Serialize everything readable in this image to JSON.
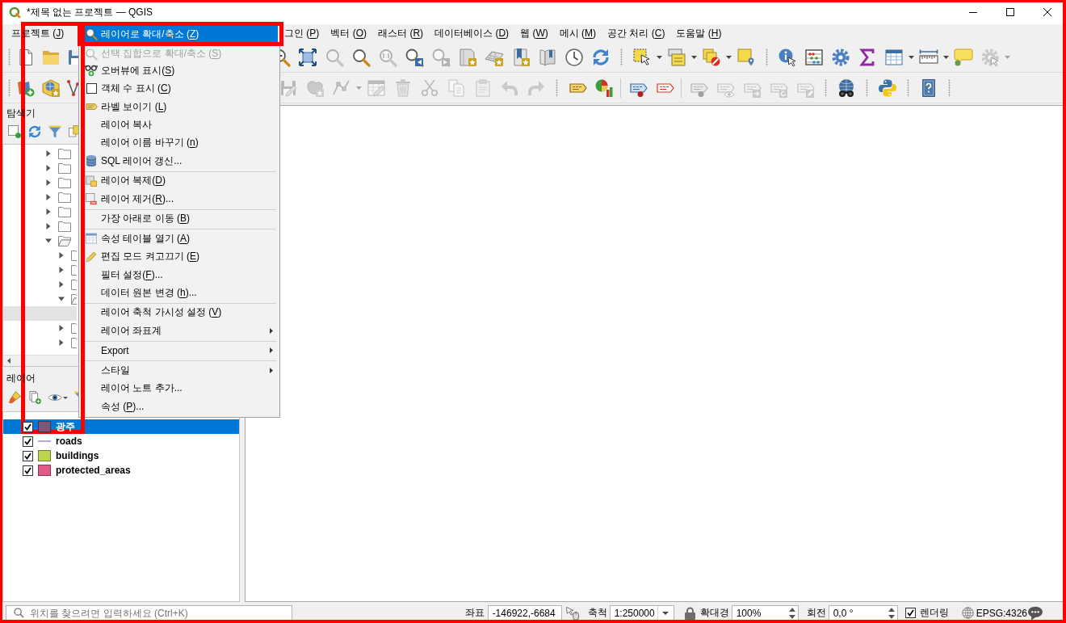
{
  "window": {
    "title": "*제목 없는 프로젝트 — QGIS"
  },
  "menu_bar": {
    "before_popup": [
      {
        "label": "프로젝트 (J)"
      }
    ],
    "after_popup": [
      {
        "label": "그인 (P)"
      },
      {
        "label": "벡터 (O)"
      },
      {
        "label": "래스터 (R)"
      },
      {
        "label": "데이터베이스 (D)"
      },
      {
        "label": "웹 (W)"
      },
      {
        "label": "메시 (M)"
      },
      {
        "label": "공간 처리 (C)"
      },
      {
        "label": "도움말 (H)"
      }
    ]
  },
  "toolbars": [
    {
      "before_popup": [
        {
          "kind": "grip"
        },
        {
          "kind": "new",
          "disabled": false
        },
        {
          "kind": "open",
          "disabled": false
        },
        {
          "kind": "save",
          "disabled": false
        }
      ],
      "after_popup": [
        {
          "kind": "zoomout",
          "disabled": false
        },
        {
          "kind": "zoomfull",
          "disabled": false
        },
        {
          "kind": "zoomselection",
          "disabled": true
        },
        {
          "kind": "zoomlayer",
          "disabled": false
        },
        {
          "kind": "zoomnative",
          "disabled": true
        },
        {
          "kind": "zoomlast",
          "disabled": false
        },
        {
          "kind": "zoomnext",
          "disabled": true
        },
        {
          "kind": "mapview",
          "disabled": false
        },
        {
          "kind": "mapview3d",
          "disabled": false
        },
        {
          "kind": "bookmark",
          "disabled": false
        },
        {
          "kind": "bookmarks",
          "disabled": false
        },
        {
          "kind": "clock",
          "disabled": false
        },
        {
          "kind": "refresh",
          "disabled": false
        },
        {
          "kind": "grip"
        },
        {
          "kind": "select",
          "disabled": false
        },
        {
          "kind": "caret",
          "disabled": false
        },
        {
          "kind": "selectvalue",
          "disabled": false
        },
        {
          "kind": "caret",
          "disabled": false
        },
        {
          "kind": "deselect",
          "disabled": false
        },
        {
          "kind": "caret",
          "disabled": false
        },
        {
          "kind": "selectlocation",
          "disabled": false
        },
        {
          "kind": "grip"
        },
        {
          "kind": "identify",
          "disabled": false
        },
        {
          "kind": "abacus",
          "disabled": false
        },
        {
          "kind": "gear",
          "disabled": false
        },
        {
          "kind": "sigma",
          "disabled": false
        },
        {
          "kind": "table",
          "disabled": false
        },
        {
          "kind": "caret",
          "disabled": false
        },
        {
          "kind": "ruler",
          "disabled": false
        },
        {
          "kind": "caret",
          "disabled": false
        },
        {
          "kind": "maptip",
          "disabled": false
        },
        {
          "kind": "gearplay",
          "disabled": true
        },
        {
          "kind": "caret",
          "disabled": true
        }
      ]
    },
    {
      "before_popup": [
        {
          "kind": "grip"
        },
        {
          "kind": "datasource",
          "disabled": false
        },
        {
          "kind": "globebox",
          "disabled": false
        },
        {
          "kind": "polyline",
          "disabled": false
        }
      ],
      "after_popup": [
        {
          "kind": "saveedits",
          "disabled": true
        },
        {
          "kind": "addpolygon",
          "disabled": true
        },
        {
          "kind": "nodetool",
          "disabled": true
        },
        {
          "kind": "caret",
          "disabled": true
        },
        {
          "kind": "edittable",
          "disabled": true
        },
        {
          "kind": "trash",
          "disabled": true
        },
        {
          "kind": "cut",
          "disabled": true
        },
        {
          "kind": "copy",
          "disabled": true
        },
        {
          "kind": "paste",
          "disabled": true
        },
        {
          "kind": "undo",
          "disabled": true
        },
        {
          "kind": "redo",
          "disabled": true
        },
        {
          "kind": "grip"
        },
        {
          "kind": "label",
          "disabled": false
        },
        {
          "kind": "diagram",
          "disabled": false
        },
        {
          "kind": "separator"
        },
        {
          "kind": "labelpin",
          "disabled": false
        },
        {
          "kind": "labelred",
          "disabled": false
        },
        {
          "kind": "separator"
        },
        {
          "kind": "labelpin",
          "disabled": true
        },
        {
          "kind": "labeleye",
          "disabled": true
        },
        {
          "kind": "labelmove",
          "disabled": true
        },
        {
          "kind": "labelrotate",
          "disabled": true
        },
        {
          "kind": "labeledit",
          "disabled": true
        },
        {
          "kind": "grip"
        },
        {
          "kind": "globebinoculars",
          "disabled": false
        },
        {
          "kind": "grip"
        },
        {
          "kind": "python",
          "disabled": false
        },
        {
          "kind": "grip"
        },
        {
          "kind": "help",
          "disabled": false
        },
        {
          "kind": "grip"
        }
      ]
    }
  ],
  "browser_panel": {
    "title": "탐색기",
    "tree": [
      {
        "expanded": false,
        "selected": false
      },
      {
        "expanded": false,
        "selected": false
      },
      {
        "expanded": false,
        "selected": false
      },
      {
        "expanded": false,
        "selected": false
      },
      {
        "expanded": false,
        "selected": false
      },
      {
        "expanded": false,
        "selected": false
      },
      {
        "expanded": true,
        "selected": false,
        "children": [
          {
            "expanded": false,
            "selected": false
          },
          {
            "expanded": false,
            "selected": false
          },
          {
            "expanded": false,
            "selected": false
          },
          {
            "expanded": true,
            "selected": false,
            "children": [
              {
                "selected": true
              }
            ]
          },
          {
            "expanded": false,
            "selected": false
          },
          {
            "expanded": false,
            "selected": false
          }
        ]
      }
    ]
  },
  "layers_panel": {
    "title": "레이어",
    "layers": [
      {
        "name": "광주",
        "checked": true,
        "selected": true,
        "kind": "fill",
        "color": "#7c5878"
      },
      {
        "name": "roads",
        "checked": true,
        "selected": false,
        "kind": "line",
        "color": "#b9a5d6"
      },
      {
        "name": "buildings",
        "checked": true,
        "selected": false,
        "kind": "fill",
        "color": "#bed24f"
      },
      {
        "name": "protected_areas",
        "checked": true,
        "selected": false,
        "kind": "fill",
        "color": "#e15989"
      }
    ]
  },
  "context_menu": {
    "items": [
      {
        "label": "레이어로 확대/축소 (Z)",
        "kind": "zoom",
        "selected": true,
        "disabled": false
      },
      {
        "label": "선택 집합으로 확대/축소 (S)",
        "kind": "zoom",
        "selected": false,
        "disabled": true
      },
      {
        "label": "오버뷰에 표시(S)",
        "kind": "overview",
        "selected": false,
        "disabled": false
      },
      {
        "label": "객체 수 표시 (C)",
        "kind": "checkbox",
        "checked": false,
        "selected": false,
        "disabled": false
      },
      {
        "label": "라벨 보이기 (L)",
        "kind": "label",
        "selected": false,
        "disabled": false
      },
      {
        "label": "레이어 복사",
        "kind": "plain",
        "selected": false,
        "disabled": false
      },
      {
        "label": "레이어 이름 바꾸기 (n)",
        "kind": "plain",
        "selected": false,
        "disabled": false
      },
      {
        "label": "SQL 레이어 갱신...",
        "kind": "database",
        "selected": false,
        "disabled": false
      },
      {
        "kind": "separator"
      },
      {
        "label": "레이어 복제(D)",
        "kind": "duplicate",
        "selected": false,
        "disabled": false
      },
      {
        "label": "레이어 제거(R)...",
        "kind": "remove",
        "selected": false,
        "disabled": false
      },
      {
        "kind": "separator"
      },
      {
        "label": "가장 아래로 이동 (B)",
        "kind": "plain",
        "selected": false,
        "disabled": false
      },
      {
        "kind": "separator"
      },
      {
        "label": "속성 테이블 열기 (A)",
        "kind": "table",
        "selected": false,
        "disabled": false
      },
      {
        "label": "편집 모드 켜고끄기 (E)",
        "kind": "pencil",
        "selected": false,
        "disabled": false
      },
      {
        "label": "필터 설정(F)...",
        "kind": "plain",
        "selected": false,
        "disabled": false
      },
      {
        "label": "데이터 원본 변경 (h)...",
        "kind": "plain",
        "selected": false,
        "disabled": false
      },
      {
        "kind": "separator"
      },
      {
        "label": "레이어 축척 가시성 설정 (V)",
        "kind": "plain",
        "selected": false,
        "disabled": false
      },
      {
        "label": "레이어 좌표계",
        "kind": "submenu",
        "selected": false,
        "disabled": false
      },
      {
        "kind": "separator"
      },
      {
        "label": "Export",
        "kind": "submenu",
        "selected": false,
        "disabled": false
      },
      {
        "kind": "separator"
      },
      {
        "label": "스타일",
        "kind": "submenu",
        "selected": false,
        "disabled": false
      },
      {
        "label": "레이어 노트 추가...",
        "kind": "plain",
        "selected": false,
        "disabled": false
      },
      {
        "label": "속성 (P)...",
        "kind": "plain",
        "selected": false,
        "disabled": false
      }
    ]
  },
  "status_bar": {
    "search": {
      "placeholder": "위치를 찾으려면 입력하세요 (Ctrl+K)"
    },
    "coordinate_label": "좌표",
    "coordinate": "-146922,-6684",
    "scale_label": "축척",
    "scale": "1:250000",
    "magnifier_label": "확대경",
    "magnifier": "100%",
    "rotation_label": "회전",
    "rotation": "0,0 °",
    "render": {
      "label": "렌더링",
      "checked": true
    },
    "crs": "EPSG:4326"
  }
}
